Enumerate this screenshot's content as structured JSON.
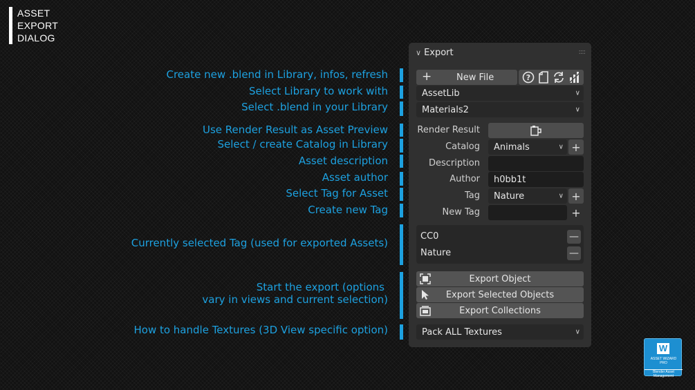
{
  "page_title": [
    "ASSET",
    "EXPORT",
    "DIALOG"
  ],
  "annotations": [
    "Create new .blend in Library, infos, refresh",
    "Select Library to work with",
    "Select .blend in your Library",
    "Use Render Result as Asset Preview",
    "Select / create Catalog in Library",
    "Asset description",
    "Asset author",
    "Select Tag for Asset",
    "Create new Tag",
    "Currently selected Tag (used for exported Assets)",
    "Start the export (options",
    "vary in views and current selection)",
    "How to handle Textures (3D View specific option)"
  ],
  "panel": {
    "title": "Export",
    "new_file_label": "New File",
    "library": "AssetLib",
    "blend_file": "Materials2",
    "render_result_label": "Render Result",
    "catalog_label": "Catalog",
    "catalog_value": "Animals",
    "description_label": "Description",
    "description_value": "",
    "author_label": "Author",
    "author_value": "h0bb1t",
    "tag_label": "Tag",
    "tag_value": "Nature",
    "new_tag_label": "New Tag",
    "new_tag_value": "",
    "selected_tags": [
      "CC0",
      "Nature"
    ],
    "export_object": "Export Object",
    "export_selected": "Export Selected Objects",
    "export_collections": "Export Collections",
    "texture_mode": "Pack ALL Textures"
  },
  "icons": {
    "add": "plus-icon",
    "help": "question-icon",
    "info": "page-icon",
    "refresh": "refresh-icon",
    "stats": "bar-chart-icon",
    "render": "render-result-icon",
    "dropdown": "chevron-down-icon",
    "remove": "minus-icon"
  },
  "badge": {
    "letter": "W",
    "line1": "ASSET WIZARD",
    "line2": "PRO",
    "footer": "Blender Asset Management"
  },
  "colors": {
    "accent": "#1da1e0",
    "panel_bg": "#303030",
    "button_bg": "#4d4d4d",
    "field_bg": "#1d1d1d",
    "dropdown_bg": "#282828"
  }
}
